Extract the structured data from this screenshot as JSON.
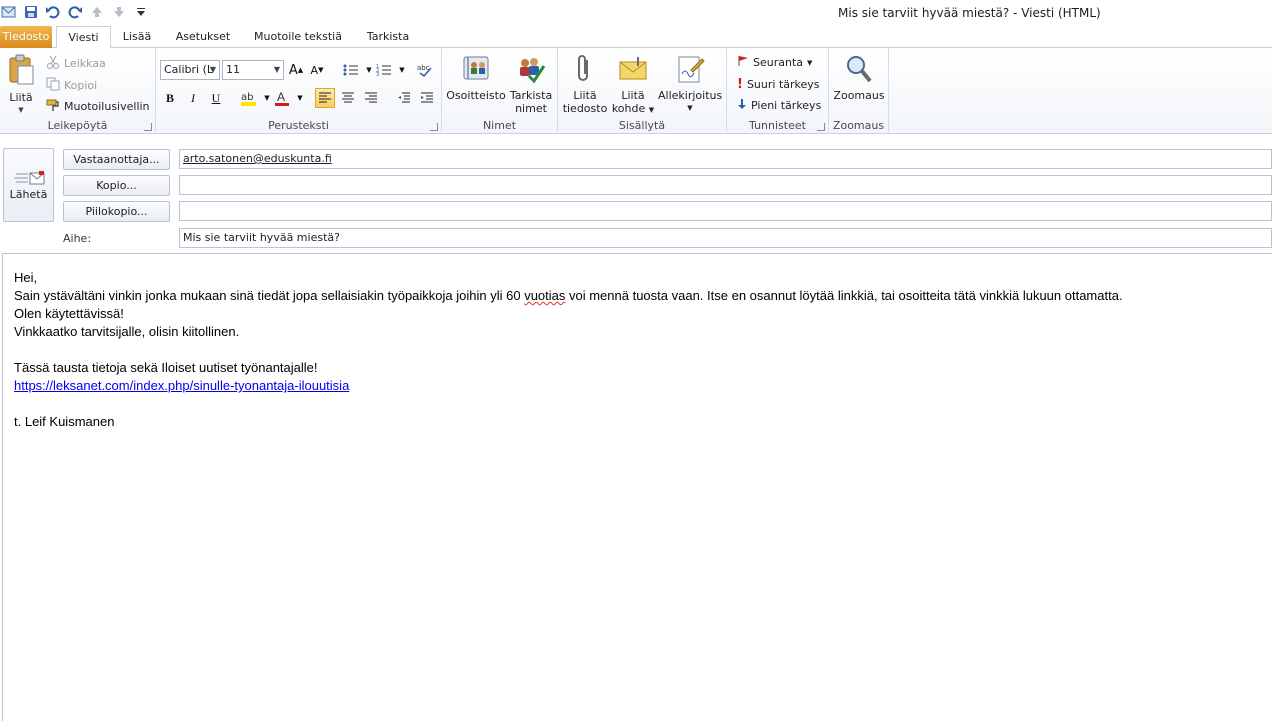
{
  "window": {
    "title": "Mis sie tarviit hyvää miestä?  -  Viesti (HTML)"
  },
  "tabs": [
    {
      "label": "Tiedosto"
    },
    {
      "label": "Viesti"
    },
    {
      "label": "Lisää"
    },
    {
      "label": "Asetukset"
    },
    {
      "label": "Muotoile tekstiä"
    },
    {
      "label": "Tarkista"
    }
  ],
  "ribbon": {
    "clipboard": {
      "label": "Leikepöytä",
      "paste": "Liitä",
      "cut": "Leikkaa",
      "copy": "Kopioi",
      "format_painter": "Muotoilusivellin"
    },
    "basic_text": {
      "label": "Perusteksti",
      "font_name": "Calibri (L",
      "font_size": "11",
      "bold": "B",
      "italic": "I",
      "underline": "U"
    },
    "names": {
      "label": "Nimet",
      "address_book": "Osoitteisto",
      "check_names_1": "Tarkista",
      "check_names_2": "nimet"
    },
    "include": {
      "label": "Sisällytä",
      "attach_file_1": "Liitä",
      "attach_file_2": "tiedosto",
      "attach_item_1": "Liitä",
      "attach_item_2": "kohde",
      "signature": "Allekirjoitus"
    },
    "tags": {
      "label": "Tunnisteet",
      "follow_up": "Seuranta",
      "high_importance": "Suuri tärkeys",
      "low_importance": "Pieni tärkeys"
    },
    "zoom": {
      "label": "Zoomaus",
      "zoom": "Zoomaus"
    }
  },
  "header": {
    "send_label": "Lähetä",
    "to_button": "Vastaanottaja...",
    "cc_button": "Kopio...",
    "bcc_button": "Piilokopio...",
    "to_value": "arto.satonen@eduskunta.fi",
    "cc_value": "",
    "bcc_value": "",
    "subject_label": "Aihe:",
    "subject_value": "Mis sie tarviit hyvää miestä?"
  },
  "body": {
    "line1": "Hei,",
    "line2_a": "Sain ystävältäni vinkin jonka mukaan sinä tiedät jopa sellaisiakin työpaikkoja joihin yli 60 ",
    "line2_b": "vuotias",
    "line2_c": " voi mennä tuosta vaan. Itse en osannut löytää linkkiä, tai osoitteita tätä vinkkiä lukuun ottamatta.",
    "line3": "Olen käytettävissä!",
    "line4": "Vinkkaatko tarvitsijalle, olisin kiitollinen.",
    "line5": "Tässä tausta tietoja sekä Iloiset uutiset työnantajalle!",
    "link": "https://leksanet.com/index.php/sinulle-tyonantaja-ilouutisia",
    "signature": "t. Leif Kuismanen"
  },
  "colors": {
    "file_tab": "#e8a33a",
    "link": "#0000ee",
    "border": "#b8c4d4"
  }
}
